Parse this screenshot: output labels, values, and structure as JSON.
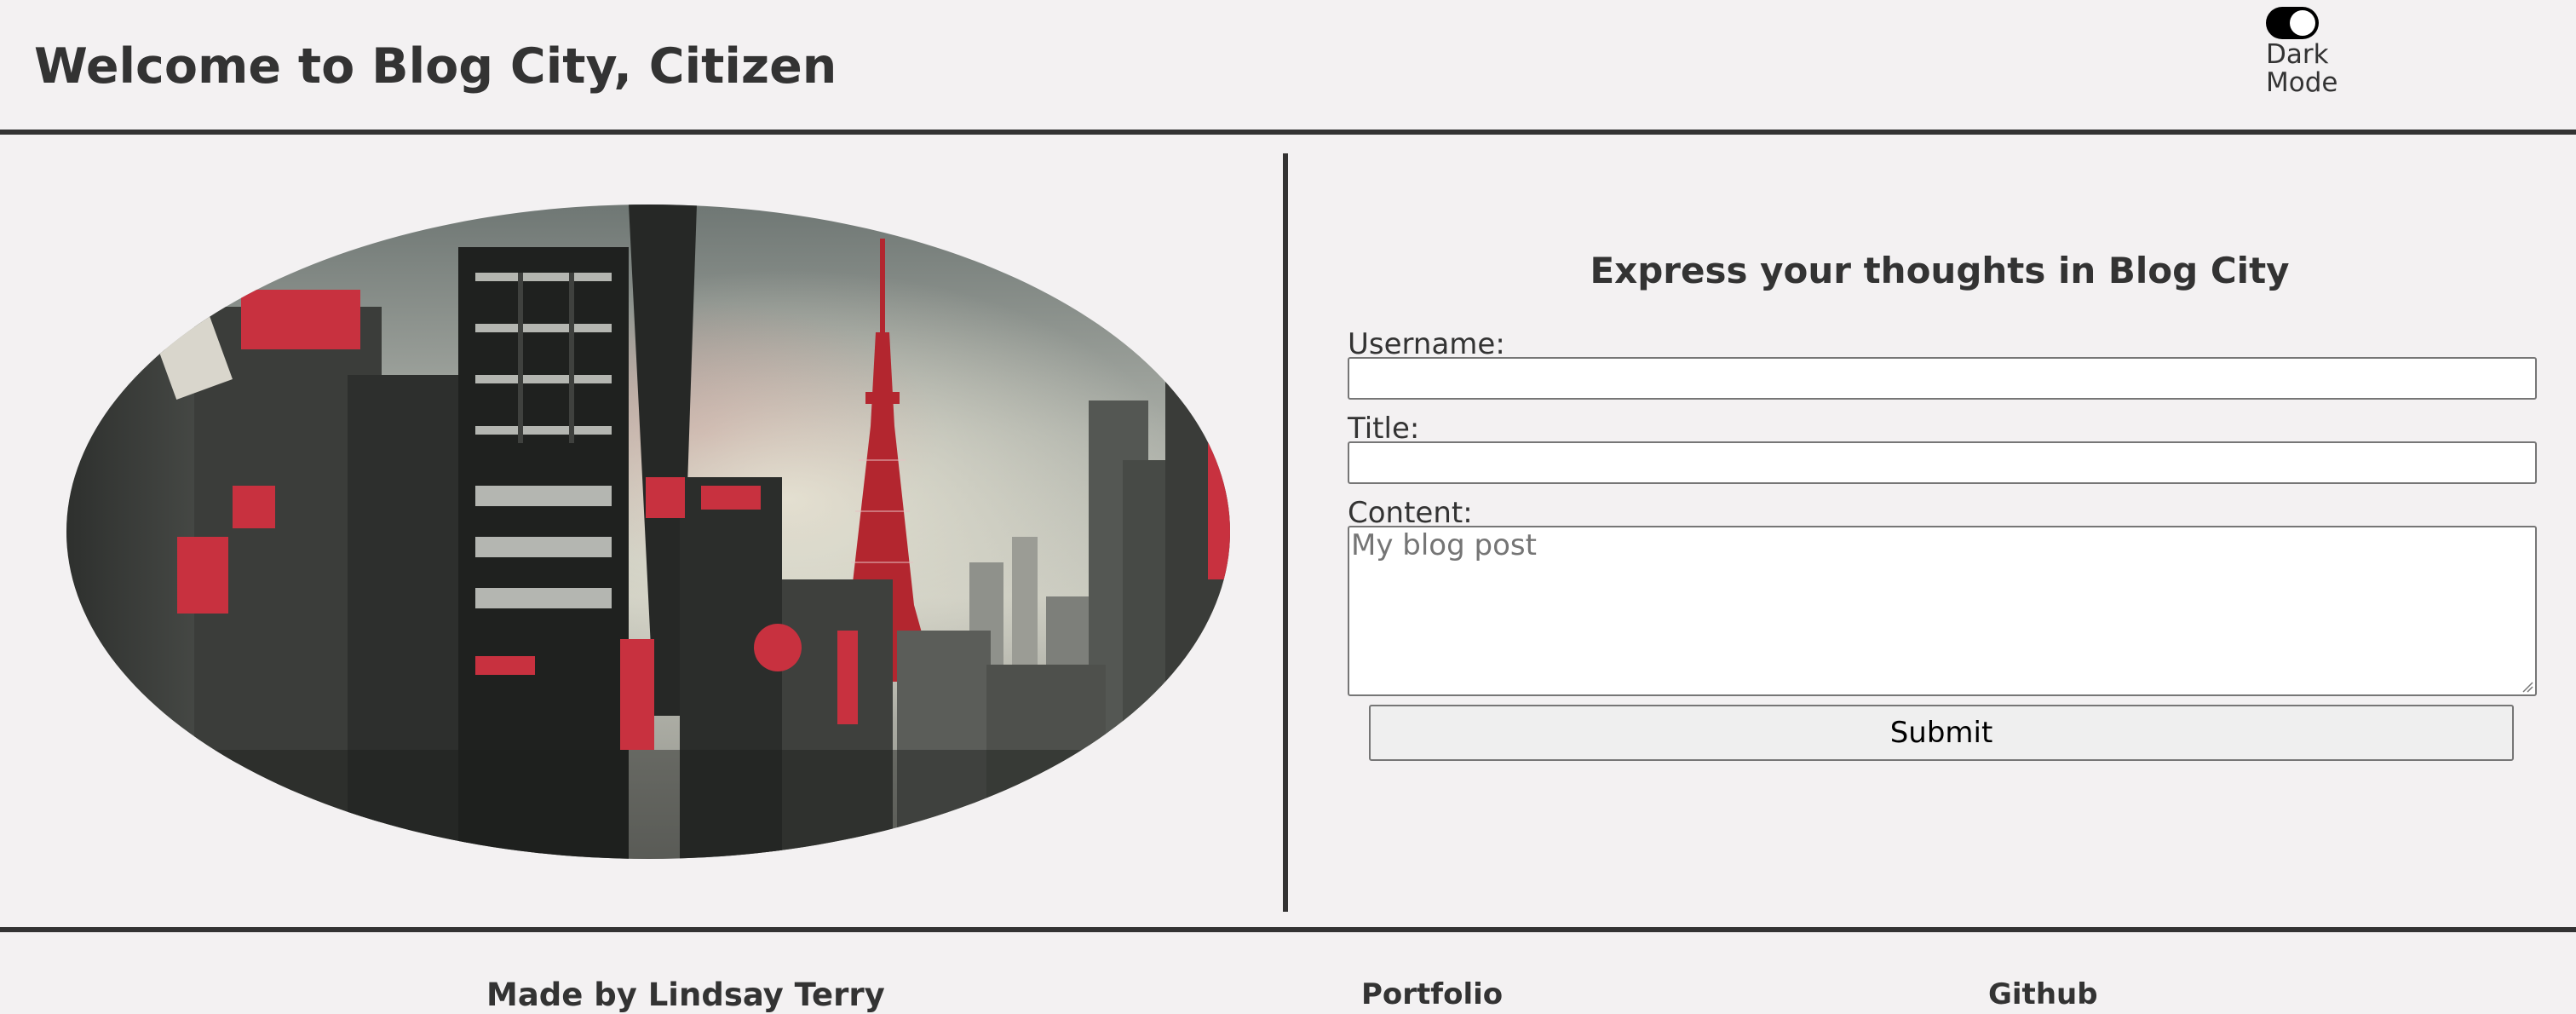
{
  "header": {
    "title": "Welcome to Blog City, Citizen",
    "dark_mode_toggle": {
      "label": "Dark Mode",
      "state": "on"
    }
  },
  "hero": {
    "image_alt": "City skyline with red tower"
  },
  "form": {
    "heading": "Express your thoughts in Blog City",
    "username_label": "Username:",
    "username_value": "",
    "title_label": "Title:",
    "title_value": "",
    "content_label": "Content:",
    "content_placeholder": "My blog post",
    "submit_label": "Submit"
  },
  "footer": {
    "credit": "Made by Lindsay Terry",
    "portfolio_link": "Portfolio",
    "github_link": "Github"
  },
  "colors": {
    "background": "#f3f1f2",
    "text": "#333333",
    "accent_red": "#c8313f"
  }
}
